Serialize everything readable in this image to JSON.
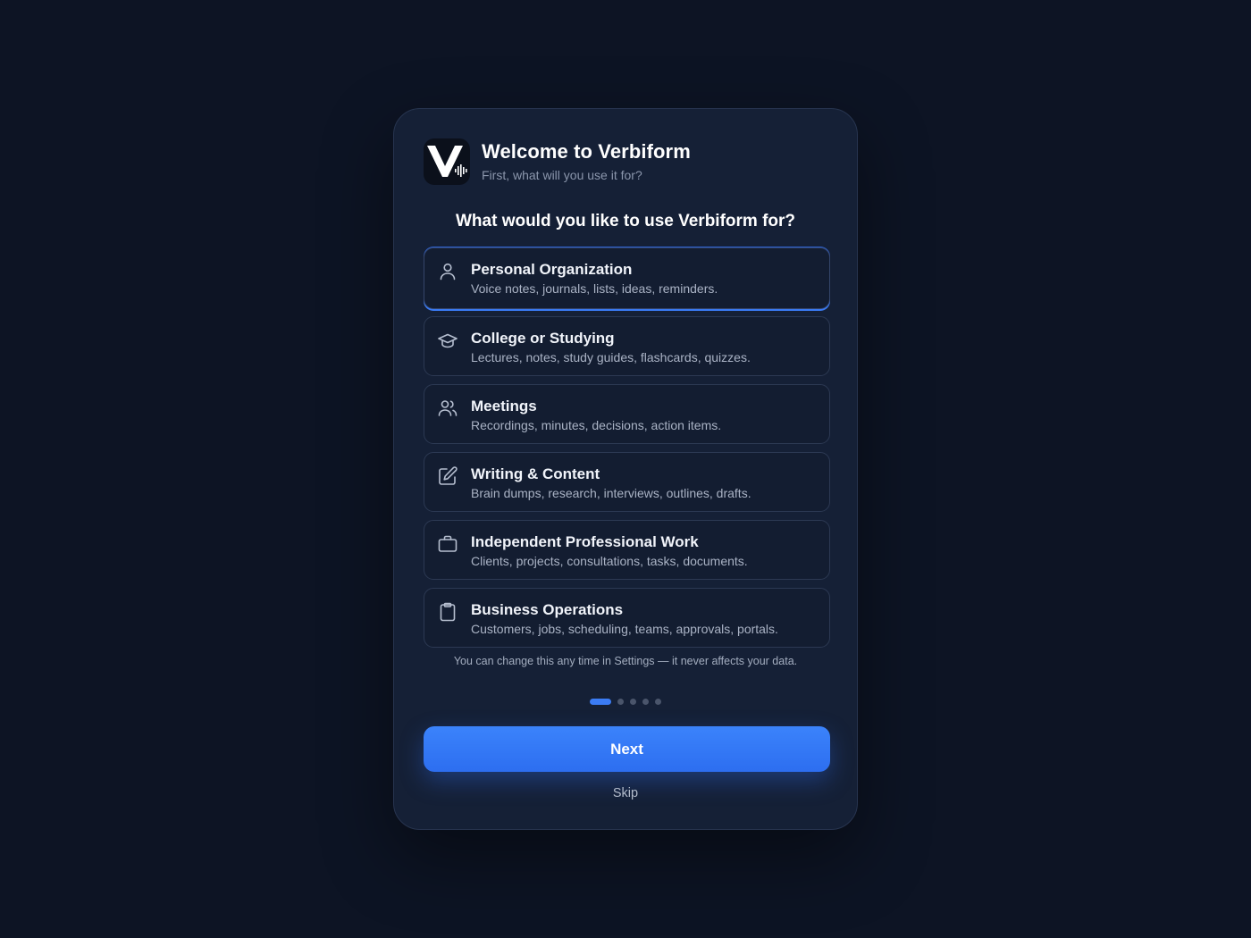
{
  "app": {
    "title": "Welcome to Verbiform",
    "subtitle": "First, what will you use it for?"
  },
  "question": "What would you like to use Verbiform for?",
  "options": [
    {
      "title": "Personal Organization",
      "description": "Voice notes, journals, lists, ideas, reminders.",
      "icon": "person-icon",
      "selected": true
    },
    {
      "title": "College or Studying",
      "description": "Lectures, notes, study guides, flashcards, quizzes.",
      "icon": "graduation-cap-icon",
      "selected": false
    },
    {
      "title": "Meetings",
      "description": "Recordings, minutes, decisions, action items.",
      "icon": "users-icon",
      "selected": false
    },
    {
      "title": "Writing & Content",
      "description": "Brain dumps, research, interviews, outlines, drafts.",
      "icon": "edit-icon",
      "selected": false
    },
    {
      "title": "Independent Professional Work",
      "description": "Clients, projects, consultations, tasks, documents.",
      "icon": "briefcase-icon",
      "selected": false
    },
    {
      "title": "Business Operations",
      "description": "Customers, jobs, scheduling, teams, approvals, portals.",
      "icon": "clipboard-icon",
      "selected": false
    }
  ],
  "footnote": "You can change this any time in Settings — it never affects your data.",
  "pagination": {
    "current": 1,
    "total": 5
  },
  "buttons": {
    "next_label": "Next",
    "skip_label": "Skip"
  },
  "colors": {
    "background": "#0d1424",
    "card": "#152036",
    "accent": "#3b7cf4"
  }
}
